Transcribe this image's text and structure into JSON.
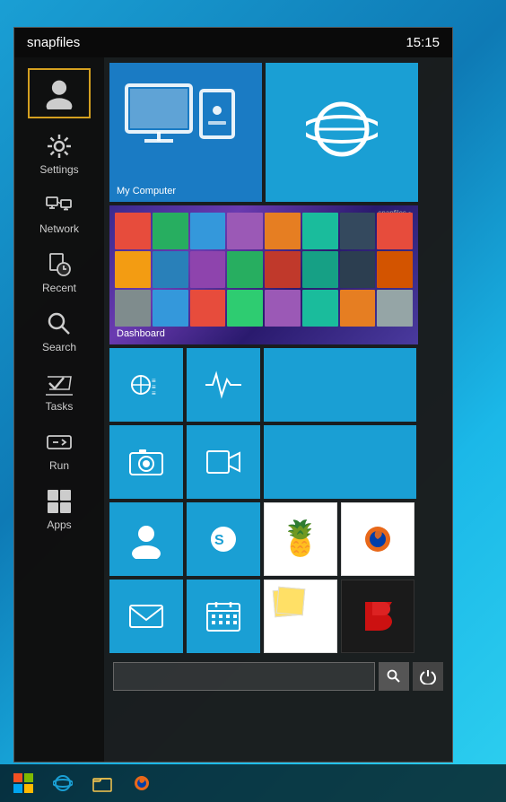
{
  "header": {
    "title": "snapfiles",
    "time": "15:15"
  },
  "sidebar": {
    "items": [
      {
        "id": "user",
        "label": "",
        "icon": "user"
      },
      {
        "id": "settings",
        "label": "Settings",
        "icon": "settings"
      },
      {
        "id": "network",
        "label": "Network",
        "icon": "network"
      },
      {
        "id": "recent",
        "label": "Recent",
        "icon": "recent"
      },
      {
        "id": "search",
        "label": "Search",
        "icon": "search"
      },
      {
        "id": "tasks",
        "label": "Tasks",
        "icon": "tasks"
      },
      {
        "id": "run",
        "label": "Run",
        "icon": "run"
      },
      {
        "id": "apps",
        "label": "Apps",
        "icon": "apps"
      }
    ]
  },
  "tiles": {
    "row1": [
      {
        "id": "my-computer",
        "label": "My Computer",
        "color": "#1a7bc4"
      },
      {
        "id": "ie",
        "label": "",
        "color": "#1a9fd4"
      }
    ],
    "dashboard": {
      "id": "dashboard",
      "label": "Dashboard",
      "color": "#2a1a6e"
    },
    "apps": [
      {
        "id": "stats",
        "color": "#1a9fd4"
      },
      {
        "id": "health",
        "color": "#1a9fd4"
      },
      {
        "id": "wide-blue",
        "color": "#1a9fd4"
      },
      {
        "id": "camera",
        "color": "#1a9fd4"
      },
      {
        "id": "video",
        "color": "#1a9fd4"
      },
      {
        "id": "contact",
        "color": "#1a9fd4"
      },
      {
        "id": "skype",
        "color": "#1a9fd4"
      },
      {
        "id": "tropical",
        "color": "#fff"
      },
      {
        "id": "firefox",
        "color": "#fff"
      },
      {
        "id": "mail",
        "color": "#1a9fd4"
      },
      {
        "id": "calendar",
        "color": "#1a9fd4"
      },
      {
        "id": "notes",
        "color": "#fff"
      },
      {
        "id": "revo",
        "color": "#1a1a1a"
      }
    ]
  },
  "search": {
    "placeholder": "",
    "search_btn_icon": "🔍",
    "power_icon": "⏻"
  },
  "taskbar": {
    "items": [
      {
        "id": "start",
        "label": "⊞"
      },
      {
        "id": "ie",
        "label": "e"
      },
      {
        "id": "explorer",
        "label": "📁"
      },
      {
        "id": "firefox",
        "label": "🦊"
      }
    ]
  }
}
